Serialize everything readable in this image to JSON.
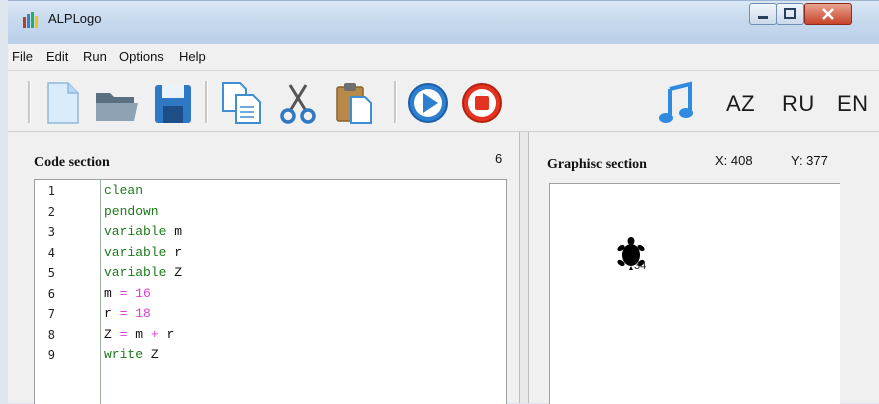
{
  "window": {
    "title": "ALPLogo"
  },
  "menu": [
    "File",
    "Edit",
    "Run",
    "Options",
    "Help"
  ],
  "toolbar": {
    "languages": [
      "AZ",
      "RU",
      "EN"
    ]
  },
  "code": {
    "title": "Code section",
    "line_count": "6",
    "lines": [
      {
        "num": "1",
        "parts": [
          {
            "t": "clean",
            "c": "kw"
          }
        ]
      },
      {
        "num": "2",
        "parts": [
          {
            "t": "pendown",
            "c": "kw"
          }
        ]
      },
      {
        "num": "3",
        "parts": [
          {
            "t": "variable",
            "c": "kw"
          },
          {
            "t": " m",
            "c": "id"
          }
        ]
      },
      {
        "num": "4",
        "parts": [
          {
            "t": "variable",
            "c": "kw"
          },
          {
            "t": " r",
            "c": "id"
          }
        ]
      },
      {
        "num": "5",
        "parts": [
          {
            "t": "variable",
            "c": "kw"
          },
          {
            "t": " Z",
            "c": "id"
          }
        ]
      },
      {
        "num": "6",
        "parts": [
          {
            "t": "m",
            "c": "id"
          },
          {
            "t": " = 16",
            "c": "op"
          }
        ]
      },
      {
        "num": "7",
        "parts": [
          {
            "t": "r",
            "c": "id"
          },
          {
            "t": " = 18",
            "c": "op"
          }
        ]
      },
      {
        "num": "8",
        "parts": [
          {
            "t": "Z",
            "c": "id"
          },
          {
            "t": " = ",
            "c": "op"
          },
          {
            "t": "m",
            "c": "id"
          },
          {
            "t": " + ",
            "c": "op"
          },
          {
            "t": "r",
            "c": "id"
          }
        ]
      },
      {
        "num": "9",
        "parts": [
          {
            "t": "write",
            "c": "kw"
          },
          {
            "t": " Z",
            "c": "id"
          }
        ]
      }
    ]
  },
  "graphics": {
    "title": "Graphisc section",
    "x_label": "X: 408",
    "y_label": "Y: 377",
    "turtle_output": "34"
  }
}
